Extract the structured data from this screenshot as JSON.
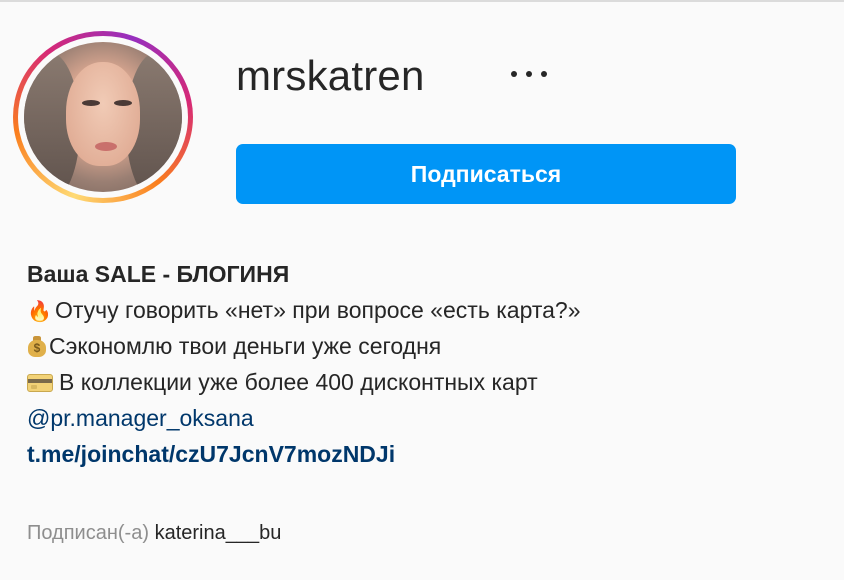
{
  "profile": {
    "username": "mrskatren",
    "more_icon": "ellipsis-icon",
    "follow_label": "Подписаться",
    "avatar_alt": "profile-photo"
  },
  "bio": {
    "name": "Ваша SALE - БЛОГИНЯ",
    "line1_icon": "🔥",
    "line1": "Отучу говорить «нет» при вопросе «есть карта?»",
    "line2_icon": "money-bag-icon",
    "line2": "Сэкономлю твои деньги уже сегодня",
    "line3_icon": "credit-card-icon",
    "line3": "В коллекции уже более 400 дисконтных карт",
    "mention": "@pr.manager_oksana",
    "link": "t.me/joinchat/czU7JcnV7mozNDJi"
  },
  "followed_by": {
    "label": "Подписан(-а)",
    "user": "katerina___bu"
  },
  "colors": {
    "follow_button": "#0095f6",
    "link": "#00376b",
    "muted": "#8e8e8e",
    "text": "#262626"
  }
}
